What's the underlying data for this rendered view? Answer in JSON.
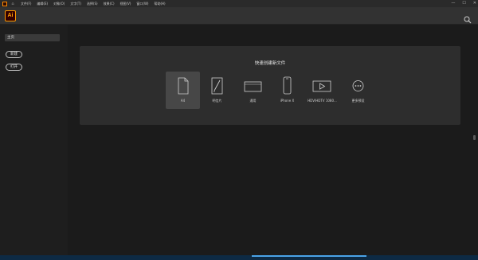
{
  "menubar": {
    "home_glyph": "⌂",
    "items": [
      "文件(F)",
      "编辑(E)",
      "对象(O)",
      "文字(T)",
      "选择(S)",
      "效果(C)",
      "视图(V)",
      "窗口(W)",
      "帮助(H)"
    ],
    "win_controls": [
      "—",
      "☐",
      "✕"
    ]
  },
  "topbar": {
    "app_logo": "Ai"
  },
  "sidebar": {
    "home_label": "主页",
    "new_label": "新建",
    "open_label": "打开"
  },
  "quick_create": {
    "title": "快速创建新文件",
    "presets": [
      {
        "label": "A4",
        "icon": "document-icon",
        "selected": true
      },
      {
        "label": "明信片",
        "icon": "postcard-icon",
        "selected": false
      },
      {
        "label": "通用",
        "icon": "general-icon",
        "selected": false
      },
      {
        "label": "iPhone X",
        "icon": "phone-icon",
        "selected": false
      },
      {
        "label": "HDV/HDTV 1080...",
        "icon": "video-icon",
        "selected": false
      },
      {
        "label": "更多预设",
        "icon": "more-icon",
        "selected": false
      }
    ]
  },
  "colors": {
    "accent_orange": "#ff9a00",
    "logo_bg": "#330000",
    "taskbar": "#0d2a44",
    "taskbar_accent": "#4aa3e8"
  }
}
